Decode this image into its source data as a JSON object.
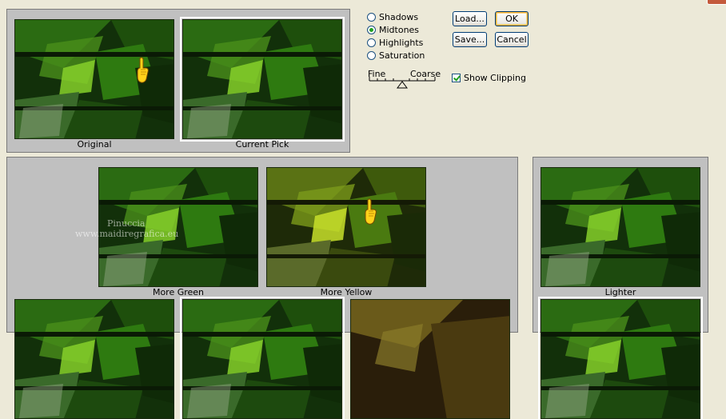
{
  "titlebar": {
    "close_icon": "close-icon",
    "close_color": "#c45a3c"
  },
  "preview": {
    "original_caption": "Original",
    "current_caption": "Current Pick"
  },
  "tones": [
    {
      "label": "Shadows",
      "selected": false
    },
    {
      "label": "Midtones",
      "selected": true
    },
    {
      "label": "Highlights",
      "selected": false
    },
    {
      "label": "Saturation",
      "selected": false
    }
  ],
  "buttons": {
    "load": "Load...",
    "save": "Save...",
    "ok": "OK",
    "cancel": "Cancel"
  },
  "slider": {
    "min_label": "Fine",
    "max_label": "Coarse"
  },
  "show_clipping": {
    "label": "Show Clipping",
    "checked": true
  },
  "variations": [
    {
      "caption": "More Green"
    },
    {
      "caption": "More Yellow"
    }
  ],
  "brightness": [
    {
      "caption": "Lighter"
    }
  ],
  "watermark": {
    "line1": "Pinuccia",
    "line2": "www.maidiregrafica.eu"
  },
  "colors": {
    "dialog_bg": "#ece9d8",
    "panel_bg": "#c0c0c0",
    "button_border": "#003c74",
    "radio_dot": "#21a121"
  }
}
